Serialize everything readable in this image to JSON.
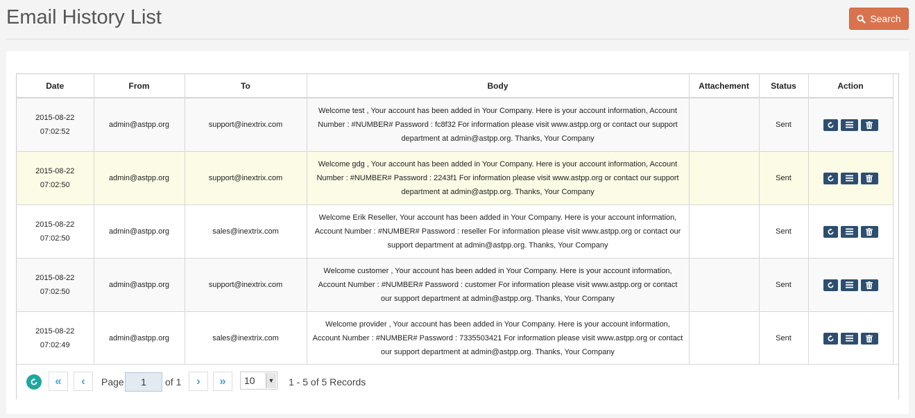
{
  "page": {
    "title": "Email History List"
  },
  "search": {
    "label": "Search"
  },
  "table": {
    "headers": {
      "date": "Date",
      "from": "From",
      "to": "To",
      "body": "Body",
      "attachment": "Attachement",
      "status": "Status",
      "action": "Action"
    },
    "rows": [
      {
        "date": "2015-08-22",
        "time": "07:02:52",
        "from": "admin@astpp.org",
        "to": "support@inextrix.com",
        "body": "Welcome test , Your account has been added in Your Company. Here is your account information, Account Number : #NUMBER# Password : fc8f32 For information please visit www.astpp.org or contact our support department at admin@astpp.org. Thanks, Your Company",
        "attachment": "",
        "status": "Sent"
      },
      {
        "date": "2015-08-22",
        "time": "07:02:50",
        "from": "admin@astpp.org",
        "to": "support@inextrix.com",
        "body": "Welcome gdg , Your account has been added in Your Company. Here is your account information, Account Number : #NUMBER# Password : 2243f1 For information please visit www.astpp.org or contact our support department at admin@astpp.org. Thanks, Your Company",
        "attachment": "",
        "status": "Sent"
      },
      {
        "date": "2015-08-22",
        "time": "07:02:50",
        "from": "admin@astpp.org",
        "to": "sales@inextrix.com",
        "body": "Welcome Erik Reseller, Your account has been added in Your Company. Here is your account information, Account Number : #NUMBER# Password : reseller For information please visit www.astpp.org or contact our support department at admin@astpp.org. Thanks, Your Company",
        "attachment": "",
        "status": "Sent"
      },
      {
        "date": "2015-08-22",
        "time": "07:02:50",
        "from": "admin@astpp.org",
        "to": "support@inextrix.com",
        "body": "Welcome customer , Your account has been added in Your Company. Here is your account information, Account Number : #NUMBER# Password : customer For information please visit www.astpp.org or contact our support department at admin@astpp.org. Thanks, Your Company",
        "attachment": "",
        "status": "Sent"
      },
      {
        "date": "2015-08-22",
        "time": "07:02:49",
        "from": "admin@astpp.org",
        "to": "sales@inextrix.com",
        "body": "Welcome provider , Your account has been added in Your Company. Here is your account information, Account Number : #NUMBER# Password : 7335503421 For information please visit www.astpp.org or contact our support department at admin@astpp.org. Thanks, Your Company",
        "attachment": "",
        "status": "Sent"
      }
    ],
    "row_actions": [
      "resend-icon",
      "details-icon",
      "delete-icon"
    ]
  },
  "pager": {
    "first": "«",
    "prev": "‹",
    "next": "›",
    "last": "»",
    "page_label": "Page",
    "page_value": "1",
    "of_label": "of 1",
    "per_page": "10",
    "records": "1 - 5 of 5 Records"
  },
  "colors": {
    "search_button": "#d9734d",
    "action_button": "#2e4e6f",
    "pager_arrow": "#4aa3d6",
    "refresh": "#1fa7a0",
    "highlight_row": "#fbfbe6"
  }
}
